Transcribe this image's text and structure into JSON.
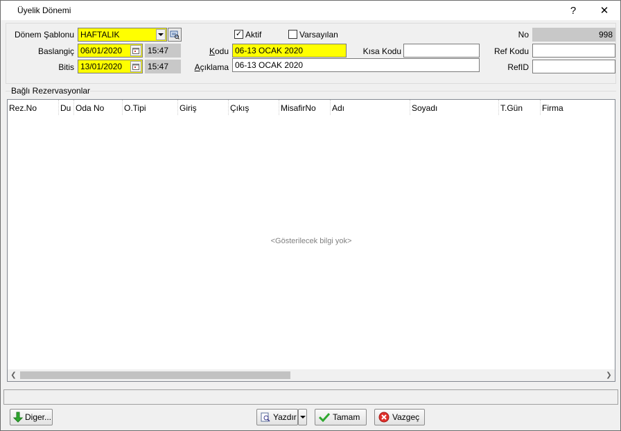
{
  "window": {
    "title": "Üyelik Dönemi",
    "help": "?",
    "close": "✕"
  },
  "form": {
    "template_label": "Dönem Şablonu",
    "template_value": "HAFTALIK",
    "start_label": "Baslangiç",
    "start_date": "06/01/2020",
    "start_time": "15:47",
    "end_label": "Bitis",
    "end_date": "13/01/2020",
    "end_time": "15:47",
    "active_label": "Aktif",
    "active_checked": true,
    "default_label": "Varsayılan",
    "default_checked": false,
    "code_label": "Kodu",
    "code_value": "06-13 OCAK 2020",
    "short_code_label": "Kısa Kodu",
    "short_code_value": "",
    "desc_label": "Açıklama",
    "desc_value": "06-13 OCAK 2020",
    "no_label": "No",
    "no_value": "998",
    "ref_code_label": "Ref Kodu",
    "ref_code_value": "",
    "ref_id_label": "RefID",
    "ref_id_value": ""
  },
  "reservations": {
    "group_label": "Bağlı Rezervasyonlar",
    "columns": [
      "Rez.No",
      "Du",
      "Oda No",
      "O.Tipi",
      "Giriş",
      "Çıkış",
      "MisafirNo",
      "Adı",
      "Soyadı",
      "T.Gün",
      "Firma"
    ],
    "empty_message": "<Gösterilecek bilgi yok>"
  },
  "buttons": {
    "other": "Diger...",
    "print": "Yazdır",
    "ok": "Tamam",
    "cancel": "Vazgeç"
  },
  "colors": {
    "required_field": "#ffff00",
    "readonly_field": "#c8c8c8"
  }
}
